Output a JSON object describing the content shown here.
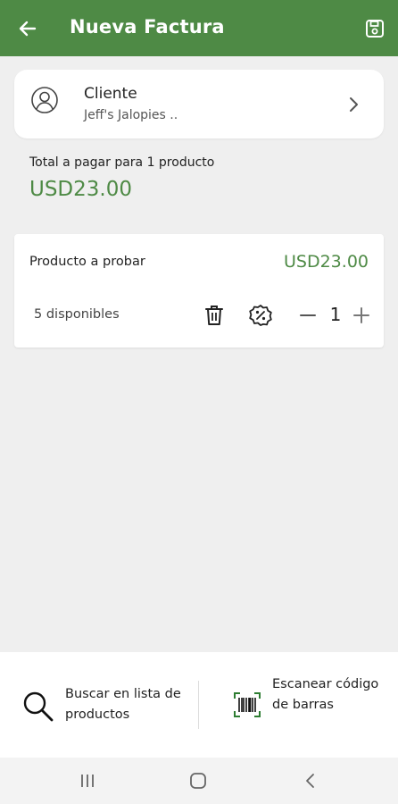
{
  "appbar": {
    "title": "Nueva Factura",
    "back_icon": "arrow-left-icon",
    "save_icon": "save-icon",
    "color": "#4e8a45"
  },
  "client": {
    "label": "Cliente",
    "name": "Jeff's Jalopies ..",
    "icon": "person-circle-icon",
    "chevron_icon": "chevron-right-icon"
  },
  "summary": {
    "label": "Total a pagar para 1 producto",
    "amount": "USD23.00"
  },
  "product": {
    "name": "Producto a probar",
    "price": "USD23.00",
    "stock": "5 disponibles",
    "quantity": "1",
    "delete_icon": "trash-icon",
    "discount_icon": "percent-badge-icon",
    "decrement_icon": "minus-icon",
    "increment_icon": "plus-icon"
  },
  "actions": {
    "search_label": "Buscar en lista de productos",
    "search_icon": "search-icon",
    "scan_label": "Escanear código de barras",
    "scan_icon": "barcode-scan-icon"
  },
  "navbar": {
    "recents_icon": "recents-icon",
    "home_icon": "home-icon",
    "back_icon": "nav-back-icon"
  },
  "colors": {
    "accent": "#4e8a45",
    "background": "#efefef"
  }
}
